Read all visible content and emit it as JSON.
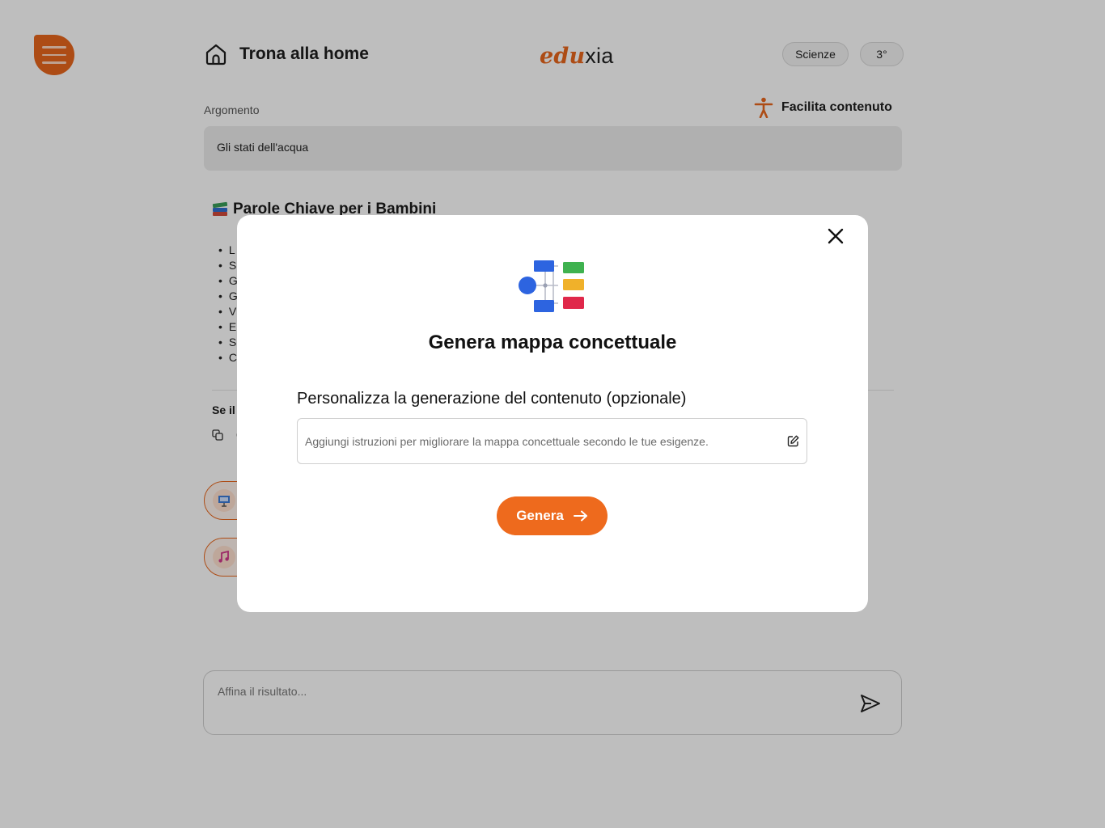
{
  "header": {
    "home_label": "Trona alla home",
    "logo_part1": "edu",
    "logo_part2": "xia",
    "subject_pill": "Scienze",
    "grade_pill": "3°"
  },
  "topic": {
    "label": "Argomento",
    "value": "Gli stati dell'acqua",
    "ease_label": "Facilita contenuto"
  },
  "content": {
    "title": "Parole Chiave per i Bambini",
    "bullets": [
      "L",
      "S",
      "G",
      "G",
      "V",
      "E",
      "S",
      "C"
    ],
    "note_prefix": "Se il"
  },
  "refine": {
    "placeholder": "Affina il risultato..."
  },
  "modal": {
    "title": "Genera mappa concettuale",
    "custom_label": "Personalizza la generazione del contenuto (opzionale)",
    "input_placeholder": "Aggiungi istruzioni per migliorare la mappa concettuale secondo le tue esigenze.",
    "button_label": "Genera"
  },
  "colors": {
    "accent": "#e8671d",
    "button": "#ee6a1d"
  },
  "icons": {
    "menu": "hamburger-icon",
    "home": "home-icon",
    "ease": "accessibility-icon",
    "send": "send-icon",
    "close": "close-icon",
    "map": "concept-map-icon",
    "edit": "edit-icon",
    "arrow": "arrow-right-icon"
  }
}
